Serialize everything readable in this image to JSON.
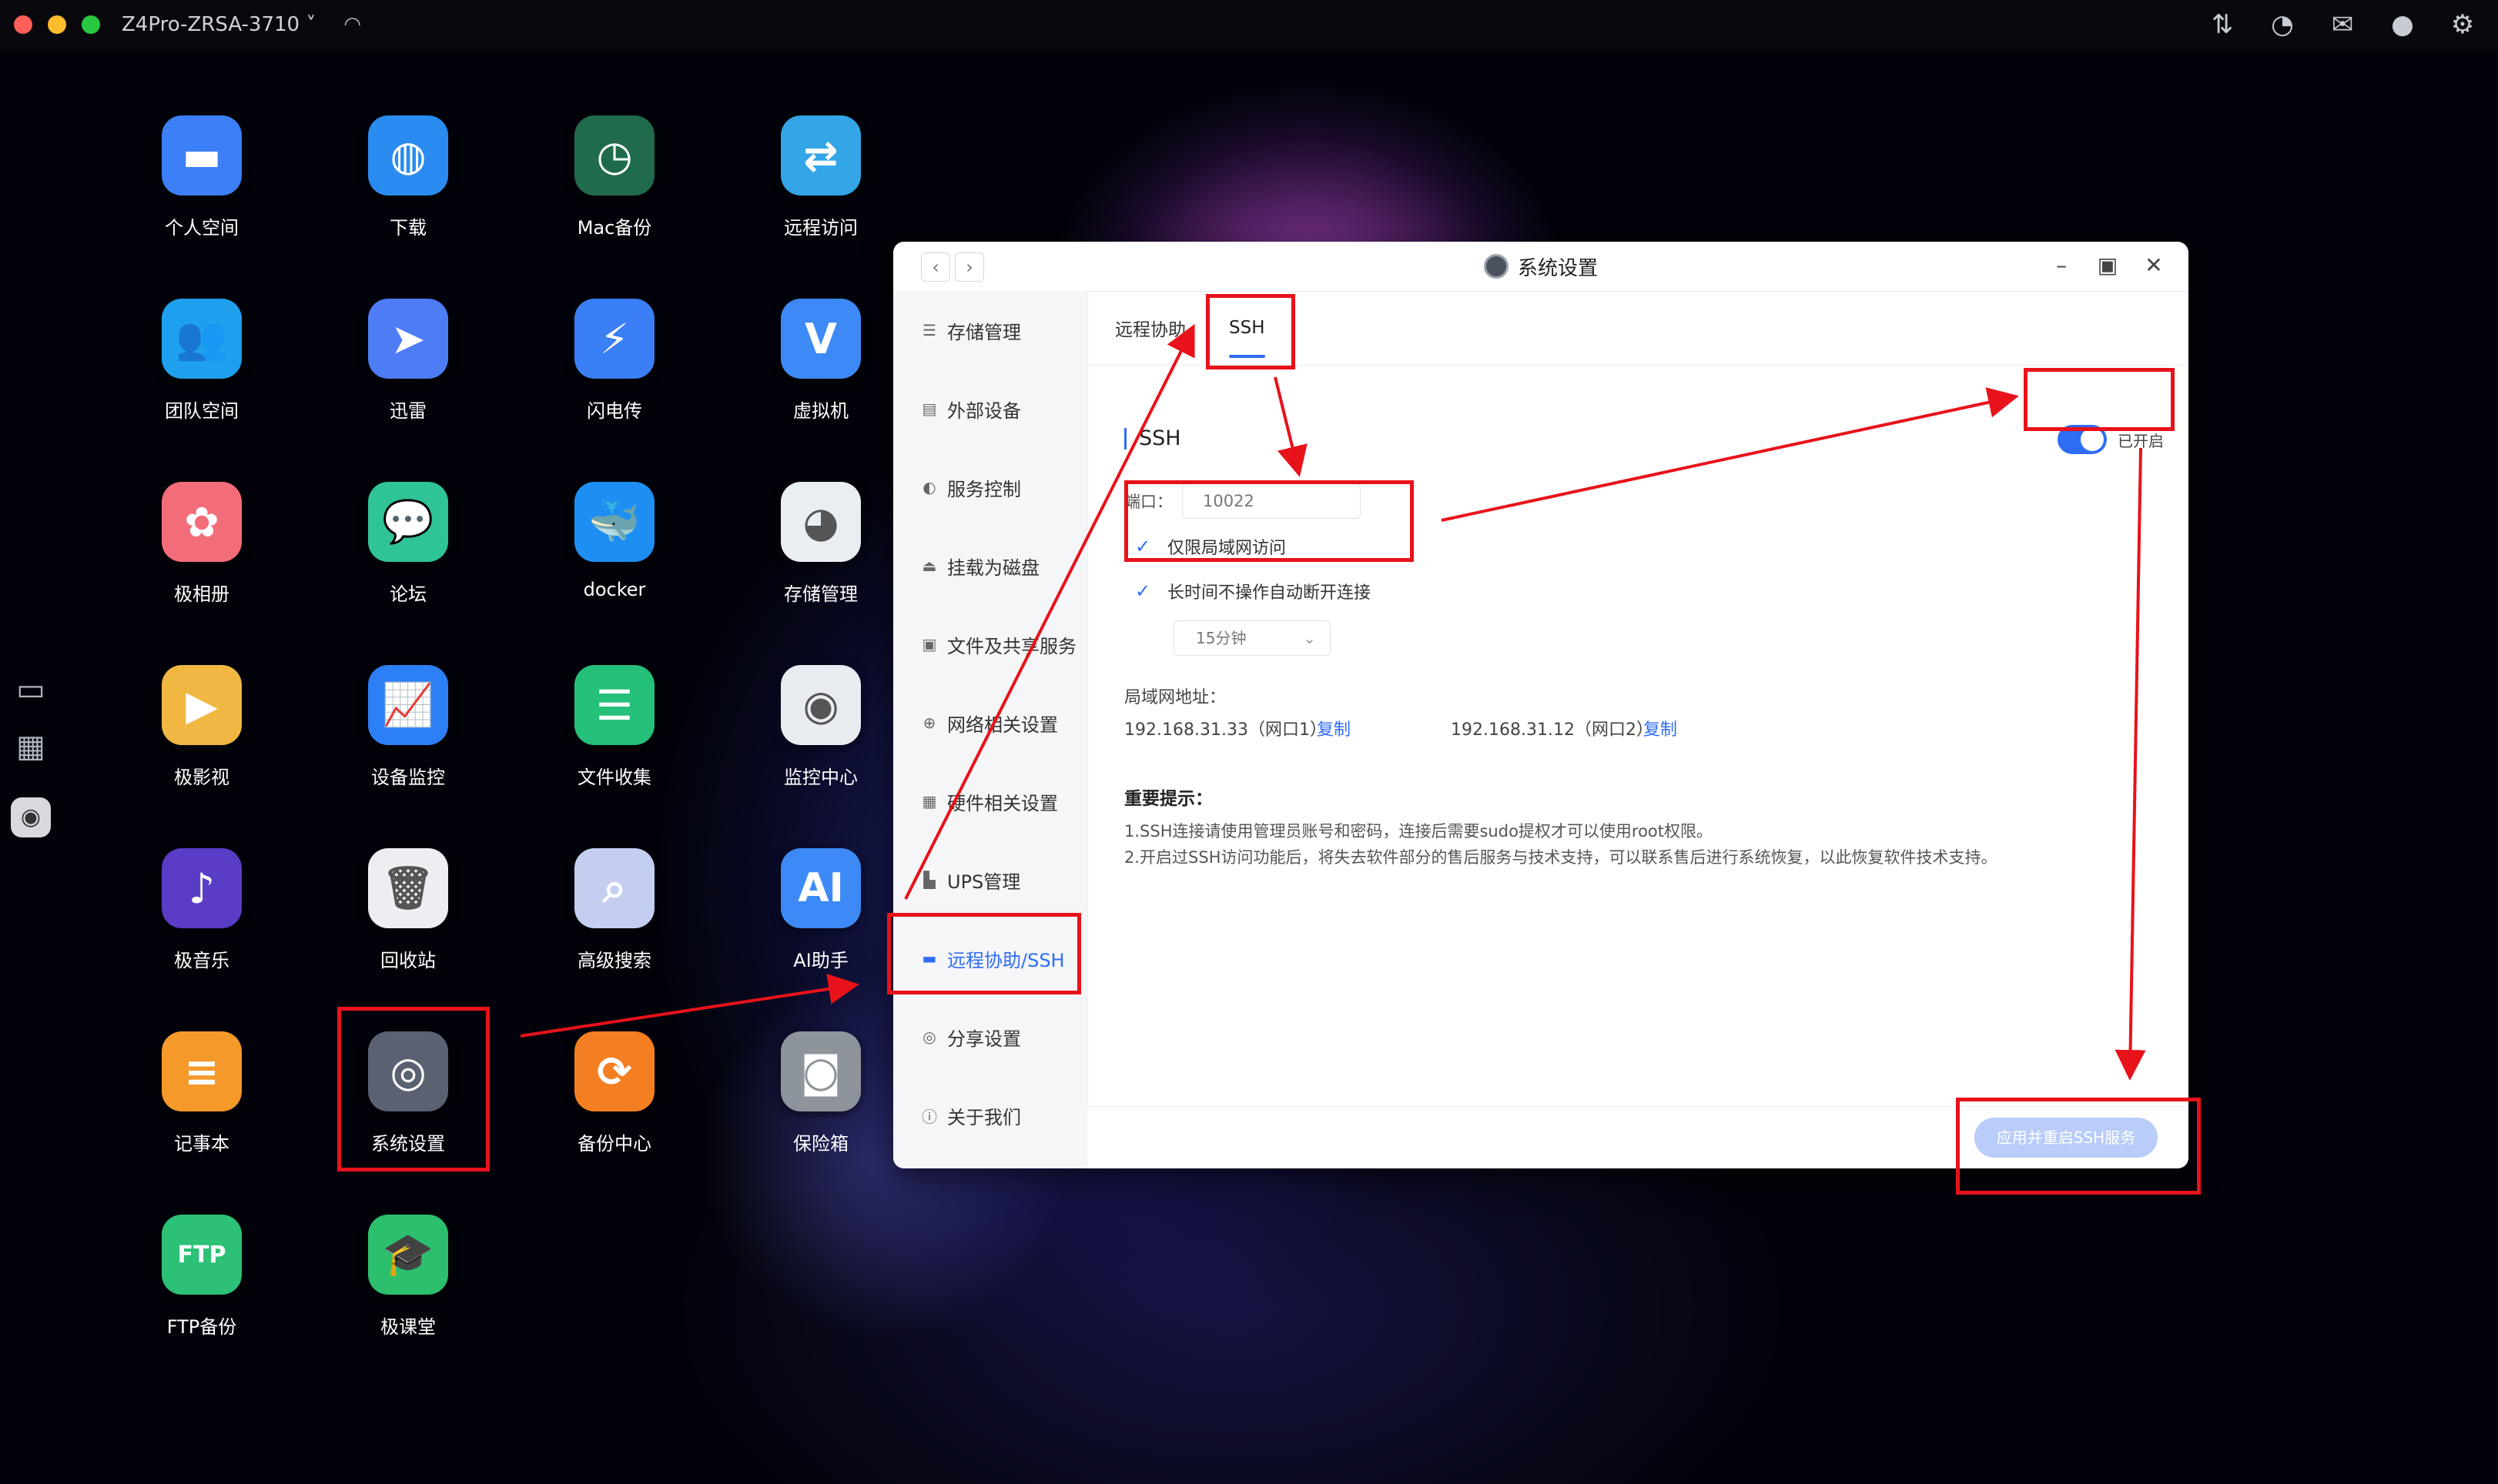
{
  "topbar": {
    "device_name": "Z4Pro-ZRSA-3710 ˅",
    "traffic_colors": [
      "#fe5f57",
      "#febc2e",
      "#28c840"
    ],
    "icons": [
      "transfer-icon",
      "speed-icon",
      "mail-icon",
      "user-icon",
      "settings-icon"
    ]
  },
  "desktop": {
    "icons": [
      {
        "label": "个人空间",
        "icon": "folder-icon",
        "color": "#3d7ff6"
      },
      {
        "label": "下载",
        "icon": "globe-download-icon",
        "color": "#2a8cf0"
      },
      {
        "label": "Mac备份",
        "icon": "time-machine-icon",
        "color": "#1f6b4c"
      },
      {
        "label": "远程访问",
        "icon": "remote-access-icon",
        "color": "#34a6e8"
      },
      {
        "label": "团队空间",
        "icon": "team-folder-icon",
        "color": "#1ea0ef"
      },
      {
        "label": "迅雷",
        "icon": "xunlei-icon",
        "color": "#4d7cf5"
      },
      {
        "label": "闪电传",
        "icon": "lightning-icon",
        "color": "#3a7ff6"
      },
      {
        "label": "虚拟机",
        "icon": "vm-icon",
        "color": "#3d8af7"
      },
      {
        "label": "极相册",
        "icon": "photos-icon",
        "color": "#f36c7a"
      },
      {
        "label": "论坛",
        "icon": "forum-icon",
        "color": "#2fc398"
      },
      {
        "label": "docker",
        "icon": "docker-icon",
        "color": "#1d8ff2"
      },
      {
        "label": "存储管理",
        "icon": "storage-icon",
        "color": "#e9eef3"
      },
      {
        "label": "极影视",
        "icon": "video-icon",
        "color": "#f0b743"
      },
      {
        "label": "设备监控",
        "icon": "monitor-chart-icon",
        "color": "#2d7ff5"
      },
      {
        "label": "文件收集",
        "icon": "file-collect-icon",
        "color": "#25c07a"
      },
      {
        "label": "监控中心",
        "icon": "camera-icon",
        "color": "#e9edf2"
      },
      {
        "label": "极音乐",
        "icon": "music-icon",
        "color": "#5a3cc6"
      },
      {
        "label": "回收站",
        "icon": "trash-icon",
        "color": "#eceef2"
      },
      {
        "label": "高级搜索",
        "icon": "search-icon",
        "color": "#c4cff0"
      },
      {
        "label": "AI助手",
        "icon": "ai-icon",
        "color": "#3d8af7"
      },
      {
        "label": "记事本",
        "icon": "notes-icon",
        "color": "#f59a2a"
      },
      {
        "label": "系统设置",
        "icon": "system-settings-icon",
        "color": "#5a6170"
      },
      {
        "label": "备份中心",
        "icon": "backup-icon",
        "color": "#f47f23"
      },
      {
        "label": "保险箱",
        "icon": "safe-icon",
        "color": "#8e949c"
      },
      {
        "label": "FTP备份",
        "icon": "ftp-icon",
        "color": "#2cc177"
      },
      {
        "label": "极课堂",
        "icon": "classroom-icon",
        "color": "#2cbf6e"
      }
    ],
    "tile_texts": {
      "ai": "AI",
      "ftp": "FTP"
    }
  },
  "window": {
    "title": "系统设置",
    "sidebar": [
      {
        "label": "存储管理",
        "icon": "storage-icon"
      },
      {
        "label": "外部设备",
        "icon": "external-device-icon"
      },
      {
        "label": "服务控制",
        "icon": "toggle-icon"
      },
      {
        "label": "挂载为磁盘",
        "icon": "mount-disk-icon"
      },
      {
        "label": "文件及共享服务",
        "icon": "file-share-icon"
      },
      {
        "label": "网络相关设置",
        "icon": "network-icon"
      },
      {
        "label": "硬件相关设置",
        "icon": "hardware-icon"
      },
      {
        "label": "UPS管理",
        "icon": "ups-icon"
      },
      {
        "label": "远程协助/SSH",
        "icon": "remote-ssh-icon"
      },
      {
        "label": "分享设置",
        "icon": "share-icon"
      },
      {
        "label": "关于我们",
        "icon": "info-icon"
      }
    ],
    "tabs": [
      "远程协助",
      "SSH"
    ],
    "section_title": "SSH",
    "toggle_label": "已开启",
    "port_label": "端口：",
    "port_value": "10022",
    "checkbox_lan_only": "仅限局域网访问",
    "checkbox_auto_disconnect": "长时间不操作自动断开连接",
    "timeout_select": "15分钟",
    "lan_label": "局域网地址：",
    "ip1": "192.168.31.33（网口1）",
    "ip2": "192.168.31.12（网口2）",
    "copy_label": "复制",
    "tips_title": "重要提示：",
    "tip1": "1.SSH连接请使用管理员账号和密码，连接后需要sudo提权才可以使用root权限。",
    "tip2": "2.开启过SSH访问功能后，将失去软件部分的售后服务与技术支持，可以联系售后进行系统恢复，以此恢复软件技术支持。",
    "apply_button": "应用并重启SSH服务",
    "accent": "#2f6cf6"
  },
  "annotation_color": "#e8121a"
}
